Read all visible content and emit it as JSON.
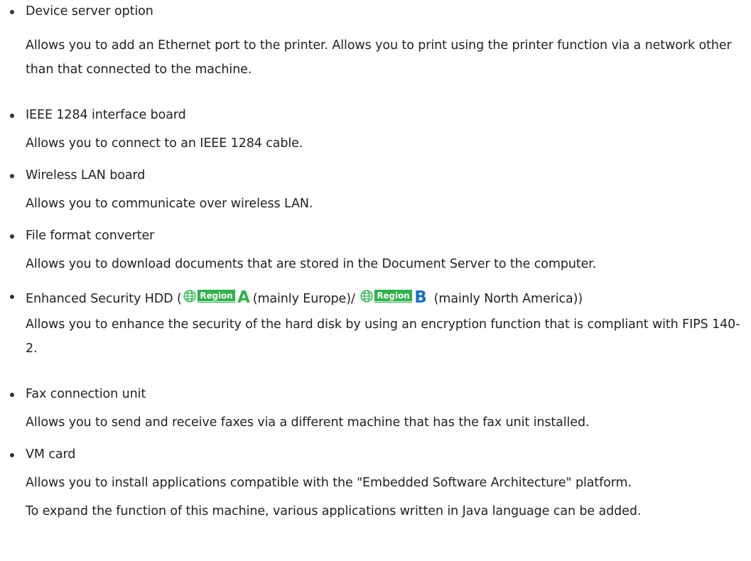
{
  "items": [
    {
      "title": "Device server option",
      "desc": [
        "Allows you to add an Ethernet port to the printer. Allows you to print using the printer function via a network other than that connected to the machine."
      ]
    },
    {
      "title": "IEEE 1284 interface board",
      "desc": [
        "Allows you to connect to an IEEE 1284 cable."
      ]
    },
    {
      "title": "Wireless LAN board",
      "desc": [
        "Allows you to communicate over wireless LAN."
      ]
    },
    {
      "title": "File format converter",
      "desc": [
        "Allows you to download documents that are stored in the Document Server to the computer."
      ]
    },
    {
      "title_prefix": "Enhanced Security HDD (",
      "region_a": {
        "word": "Region",
        "letter": "A",
        "color": "#2db24a"
      },
      "title_mid": "(mainly Europe)/ ",
      "region_b": {
        "word": "Region",
        "letter": "B",
        "color": "#1a6fc8"
      },
      "title_suffix": " (mainly North America))",
      "desc": [
        "Allows you to enhance the security of the hard disk by using an encryption function that is compliant with FIPS 140-2."
      ]
    },
    {
      "title": "Fax connection unit",
      "desc": [
        "Allows you to send and receive faxes via a different machine that has the fax unit installed."
      ]
    },
    {
      "title": "VM card",
      "desc": [
        "Allows you to install applications compatible with the \"Embedded Software Architecture\" platform.",
        "To expand the function of this machine, various applications written in Java language can be added."
      ]
    }
  ],
  "colors": {
    "text": "#222222",
    "region_a": "#2db24a",
    "region_b": "#1a6fc8"
  },
  "icons": [
    "globe-icon"
  ]
}
